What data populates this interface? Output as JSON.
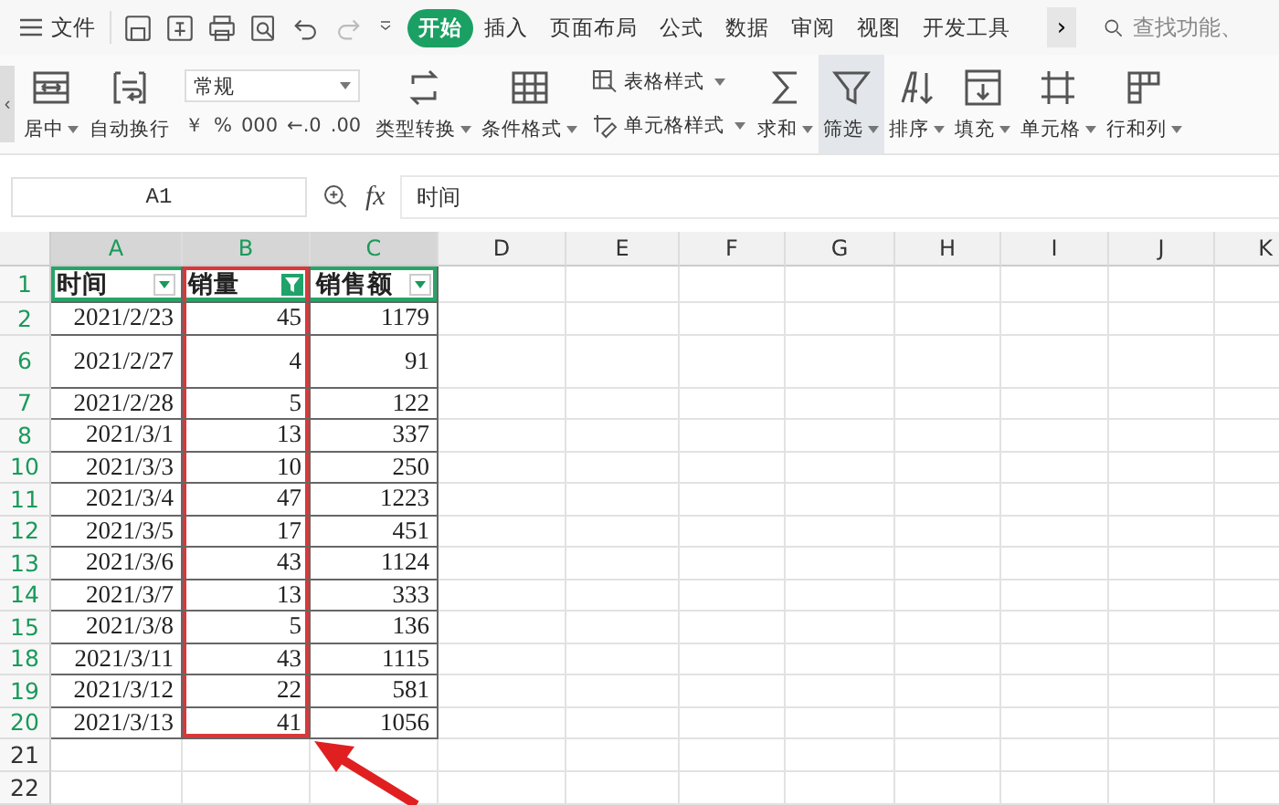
{
  "menu": {
    "label": "文件"
  },
  "tabs": [
    {
      "label": "开始",
      "selected": true
    },
    {
      "label": "插入",
      "selected": false
    },
    {
      "label": "页面布局",
      "selected": false
    },
    {
      "label": "公式",
      "selected": false
    },
    {
      "label": "数据",
      "selected": false
    },
    {
      "label": "审阅",
      "selected": false
    },
    {
      "label": "视图",
      "selected": false
    },
    {
      "label": "开发工具",
      "selected": false
    }
  ],
  "tab_scroll": "›",
  "search": {
    "placeholder": "查找功能、"
  },
  "ribbon_scroll": "‹",
  "ribbon": [
    {
      "kind": "large",
      "label": "居中",
      "caret": true,
      "selected": false
    },
    {
      "kind": "large",
      "label": "自动换行",
      "caret": false,
      "selected": false
    },
    {
      "kind": "number",
      "format": "常规",
      "symbols": [
        "￥",
        "%",
        "000",
        "←.0",
        ".00"
      ]
    },
    {
      "kind": "large",
      "label": "类型转换",
      "caret": true,
      "selected": false
    },
    {
      "kind": "large",
      "label": "条件格式",
      "caret": true,
      "selected": false
    },
    {
      "kind": "pair",
      "items": [
        "表格样式",
        "单元格样式"
      ]
    },
    {
      "kind": "large",
      "label": "求和",
      "caret": true,
      "selected": false
    },
    {
      "kind": "large",
      "label": "筛选",
      "caret": true,
      "selected": true
    },
    {
      "kind": "large",
      "label": "排序",
      "caret": true,
      "selected": false
    },
    {
      "kind": "large",
      "label": "填充",
      "caret": true,
      "selected": false
    },
    {
      "kind": "large",
      "label": "单元格",
      "caret": true,
      "selected": false
    },
    {
      "kind": "large",
      "label": "行和列",
      "caret": true,
      "selected": false
    }
  ],
  "formula_bar": {
    "name_box": "A1",
    "fx": "fx",
    "value": "时间"
  },
  "columns": [
    {
      "label": "A",
      "highlighted": true,
      "selected": false
    },
    {
      "label": "B",
      "highlighted": true,
      "selected": true
    },
    {
      "label": "C",
      "highlighted": true,
      "selected": false
    },
    {
      "label": "D",
      "highlighted": false,
      "selected": false
    },
    {
      "label": "E",
      "highlighted": false,
      "selected": false
    },
    {
      "label": "F",
      "highlighted": false,
      "selected": false
    },
    {
      "label": "G",
      "highlighted": false,
      "selected": false
    },
    {
      "label": "H",
      "highlighted": false,
      "selected": false
    },
    {
      "label": "I",
      "highlighted": false,
      "selected": false
    },
    {
      "label": "J",
      "highlighted": false,
      "selected": false
    },
    {
      "label": "K",
      "highlighted": false,
      "selected": false
    }
  ],
  "header_row": {
    "row": "1",
    "cells": [
      {
        "text": "时间",
        "filtered": false
      },
      {
        "text": "销量",
        "filtered": true
      },
      {
        "text": "销售额",
        "filtered": false
      }
    ]
  },
  "rows": [
    {
      "row": "2",
      "tall": false,
      "cells": [
        "2021/2/23",
        "45",
        "1179"
      ]
    },
    {
      "row": "6",
      "tall": true,
      "cells": [
        "2021/2/27",
        "4",
        "91"
      ]
    },
    {
      "row": "7",
      "tall": false,
      "cells": [
        "2021/2/28",
        "5",
        "122"
      ]
    },
    {
      "row": "8",
      "tall": false,
      "cells": [
        "2021/3/1",
        "13",
        "337"
      ]
    },
    {
      "row": "10",
      "tall": false,
      "cells": [
        "2021/3/3",
        "10",
        "250"
      ]
    },
    {
      "row": "11",
      "tall": false,
      "cells": [
        "2021/3/4",
        "47",
        "1223"
      ]
    },
    {
      "row": "12",
      "tall": false,
      "cells": [
        "2021/3/5",
        "17",
        "451"
      ]
    },
    {
      "row": "13",
      "tall": false,
      "cells": [
        "2021/3/6",
        "43",
        "1124"
      ]
    },
    {
      "row": "14",
      "tall": false,
      "cells": [
        "2021/3/7",
        "13",
        "333"
      ]
    },
    {
      "row": "15",
      "tall": false,
      "cells": [
        "2021/3/8",
        "5",
        "136"
      ]
    },
    {
      "row": "18",
      "tall": false,
      "cells": [
        "2021/3/11",
        "43",
        "1115"
      ]
    },
    {
      "row": "19",
      "tall": false,
      "cells": [
        "2021/3/12",
        "22",
        "581"
      ]
    },
    {
      "row": "20",
      "tall": false,
      "cells": [
        "2021/3/13",
        "41",
        "1056"
      ]
    }
  ],
  "empty_rows": [
    "21",
    "22"
  ]
}
